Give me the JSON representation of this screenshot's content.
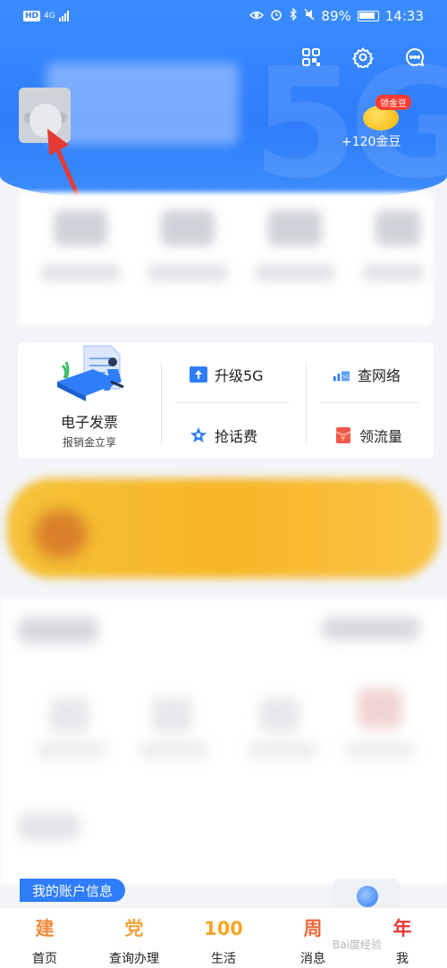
{
  "status_bar": {
    "hd": "HD",
    "network": "4G",
    "battery": "89%",
    "time": "14:33"
  },
  "header": {
    "gold_badge": "领金豆",
    "gold_amount": "+120金豆",
    "watermark_bg": "5G"
  },
  "menu": {
    "invoice_title": "电子发票",
    "invoice_sub": "报销金立享",
    "items": [
      {
        "label": "升级5G",
        "icon": "upgrade-icon",
        "color": "#2f7dfb"
      },
      {
        "label": "查网络",
        "icon": "network-icon",
        "color": "#2f7dfb"
      },
      {
        "label": "抢话费",
        "icon": "star-icon",
        "color": "#2f7dfb"
      },
      {
        "label": "领流量",
        "icon": "red-envelope-icon",
        "color": "#f05a4a"
      }
    ]
  },
  "account": {
    "tab_label": "我的账户信息"
  },
  "tabbar": {
    "items": [
      {
        "icon_text": "建",
        "label": "首页",
        "color": "#f08a3a"
      },
      {
        "icon_text": "党",
        "label": "查询办理",
        "color": "#f0a23a"
      },
      {
        "icon_text": "100",
        "label": "生活",
        "color": "#f5a623"
      },
      {
        "icon_text": "周",
        "label": "消息",
        "color": "#ee6a3a"
      },
      {
        "icon_text": "年",
        "label": "我",
        "color": "#e53935"
      }
    ]
  },
  "watermark": "Bai度经验"
}
